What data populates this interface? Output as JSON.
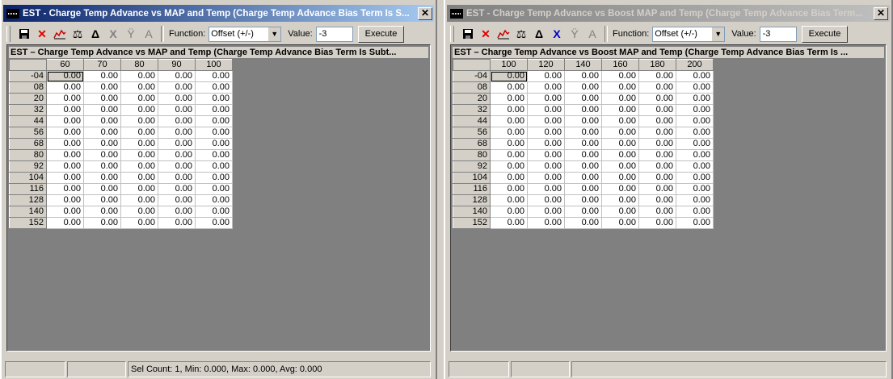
{
  "windows": [
    {
      "title": "EST - Charge Temp Advance vs MAP and Temp (Charge Temp Advance Bias Term Is S...",
      "active": true,
      "toolbar": {
        "function_label": "Function:",
        "function_value": "Offset (+/-)",
        "value_label": "Value:",
        "value": "-3",
        "execute_label": "Execute"
      },
      "table_title": "EST – Charge Temp Advance vs MAP and Temp (Charge Temp Advance Bias Term Is Subt...",
      "columns": [
        "60",
        "70",
        "80",
        "90",
        "100"
      ],
      "rows": [
        "-04",
        "08",
        "20",
        "32",
        "44",
        "56",
        "68",
        "80",
        "92",
        "104",
        "116",
        "128",
        "140",
        "152"
      ],
      "cell_value": "0.00",
      "status": [
        "",
        "",
        "Sel Count: 1, Min: 0.000, Max: 0.000, Avg: 0.000"
      ]
    },
    {
      "title": "EST - Charge Temp Advance vs Boost MAP and Temp (Charge Temp Advance Bias Term...",
      "active": false,
      "toolbar": {
        "function_label": "Function:",
        "function_value": "Offset (+/-)",
        "value_label": "Value:",
        "value": "-3",
        "execute_label": "Execute"
      },
      "table_title": "EST – Charge Temp Advance vs Boost MAP and Temp (Charge Temp Advance Bias Term Is ...",
      "columns": [
        "100",
        "120",
        "140",
        "160",
        "180",
        "200"
      ],
      "rows": [
        "-04",
        "08",
        "20",
        "32",
        "44",
        "56",
        "68",
        "80",
        "92",
        "104",
        "116",
        "128",
        "140",
        "152"
      ],
      "cell_value": "0.00",
      "status": [
        "",
        "",
        ""
      ]
    }
  ],
  "icons": [
    "save-icon",
    "delete-icon",
    "graph-icon",
    "balance-icon",
    "delta-icon",
    "x-icon",
    "interpolate-icon",
    "text-icon"
  ],
  "colors": {
    "titlebar_active": "#0a246a",
    "titlebar_inactive": "#808080",
    "workspace": "#808080",
    "chrome": "#d4d0c8"
  }
}
